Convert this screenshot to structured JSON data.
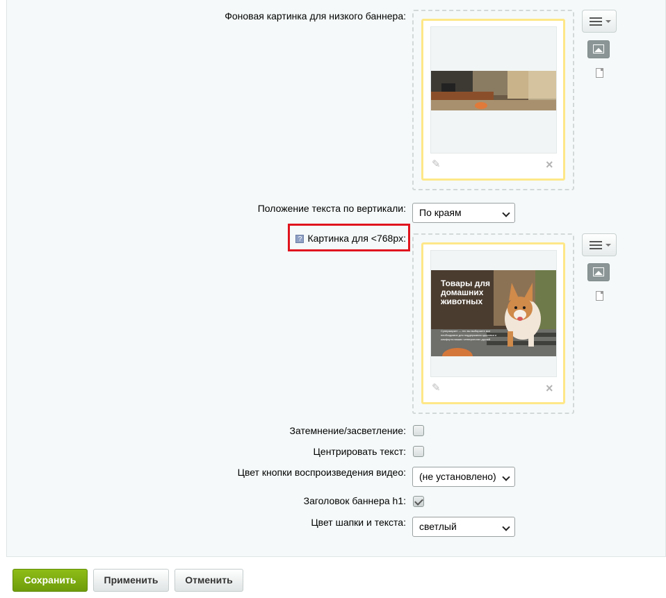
{
  "fields": {
    "bg_low_banner_label": "Фоновая картинка для низкого баннера:",
    "text_vertical_label": "Положение текста по вертикали:",
    "text_vertical_value": "По краям",
    "mobile_image_label": "Картинка для <768px:",
    "help_icon_text": "?",
    "darken_label": "Затемнение/засветление:",
    "center_text_label": "Центрировать текст:",
    "video_btn_color_label": "Цвет кнопки воспроизведения видео:",
    "video_btn_color_value": "(не установлено)",
    "h1_label": "Заголовок баннера h1:",
    "header_color_label": "Цвет шапки и текста:",
    "header_color_value": "светлый"
  },
  "mobile_banner": {
    "title": "Товары для домашних животных",
    "subtitle": "Супермаркет — это вы выбираете все необходимое для поддержания здоровья и комфорта ваших четвероногих друзей"
  },
  "checkboxes": {
    "darken": false,
    "center_text": false,
    "h1": true
  },
  "buttons": {
    "save": "Сохранить",
    "apply": "Применить",
    "cancel": "Отменить"
  }
}
